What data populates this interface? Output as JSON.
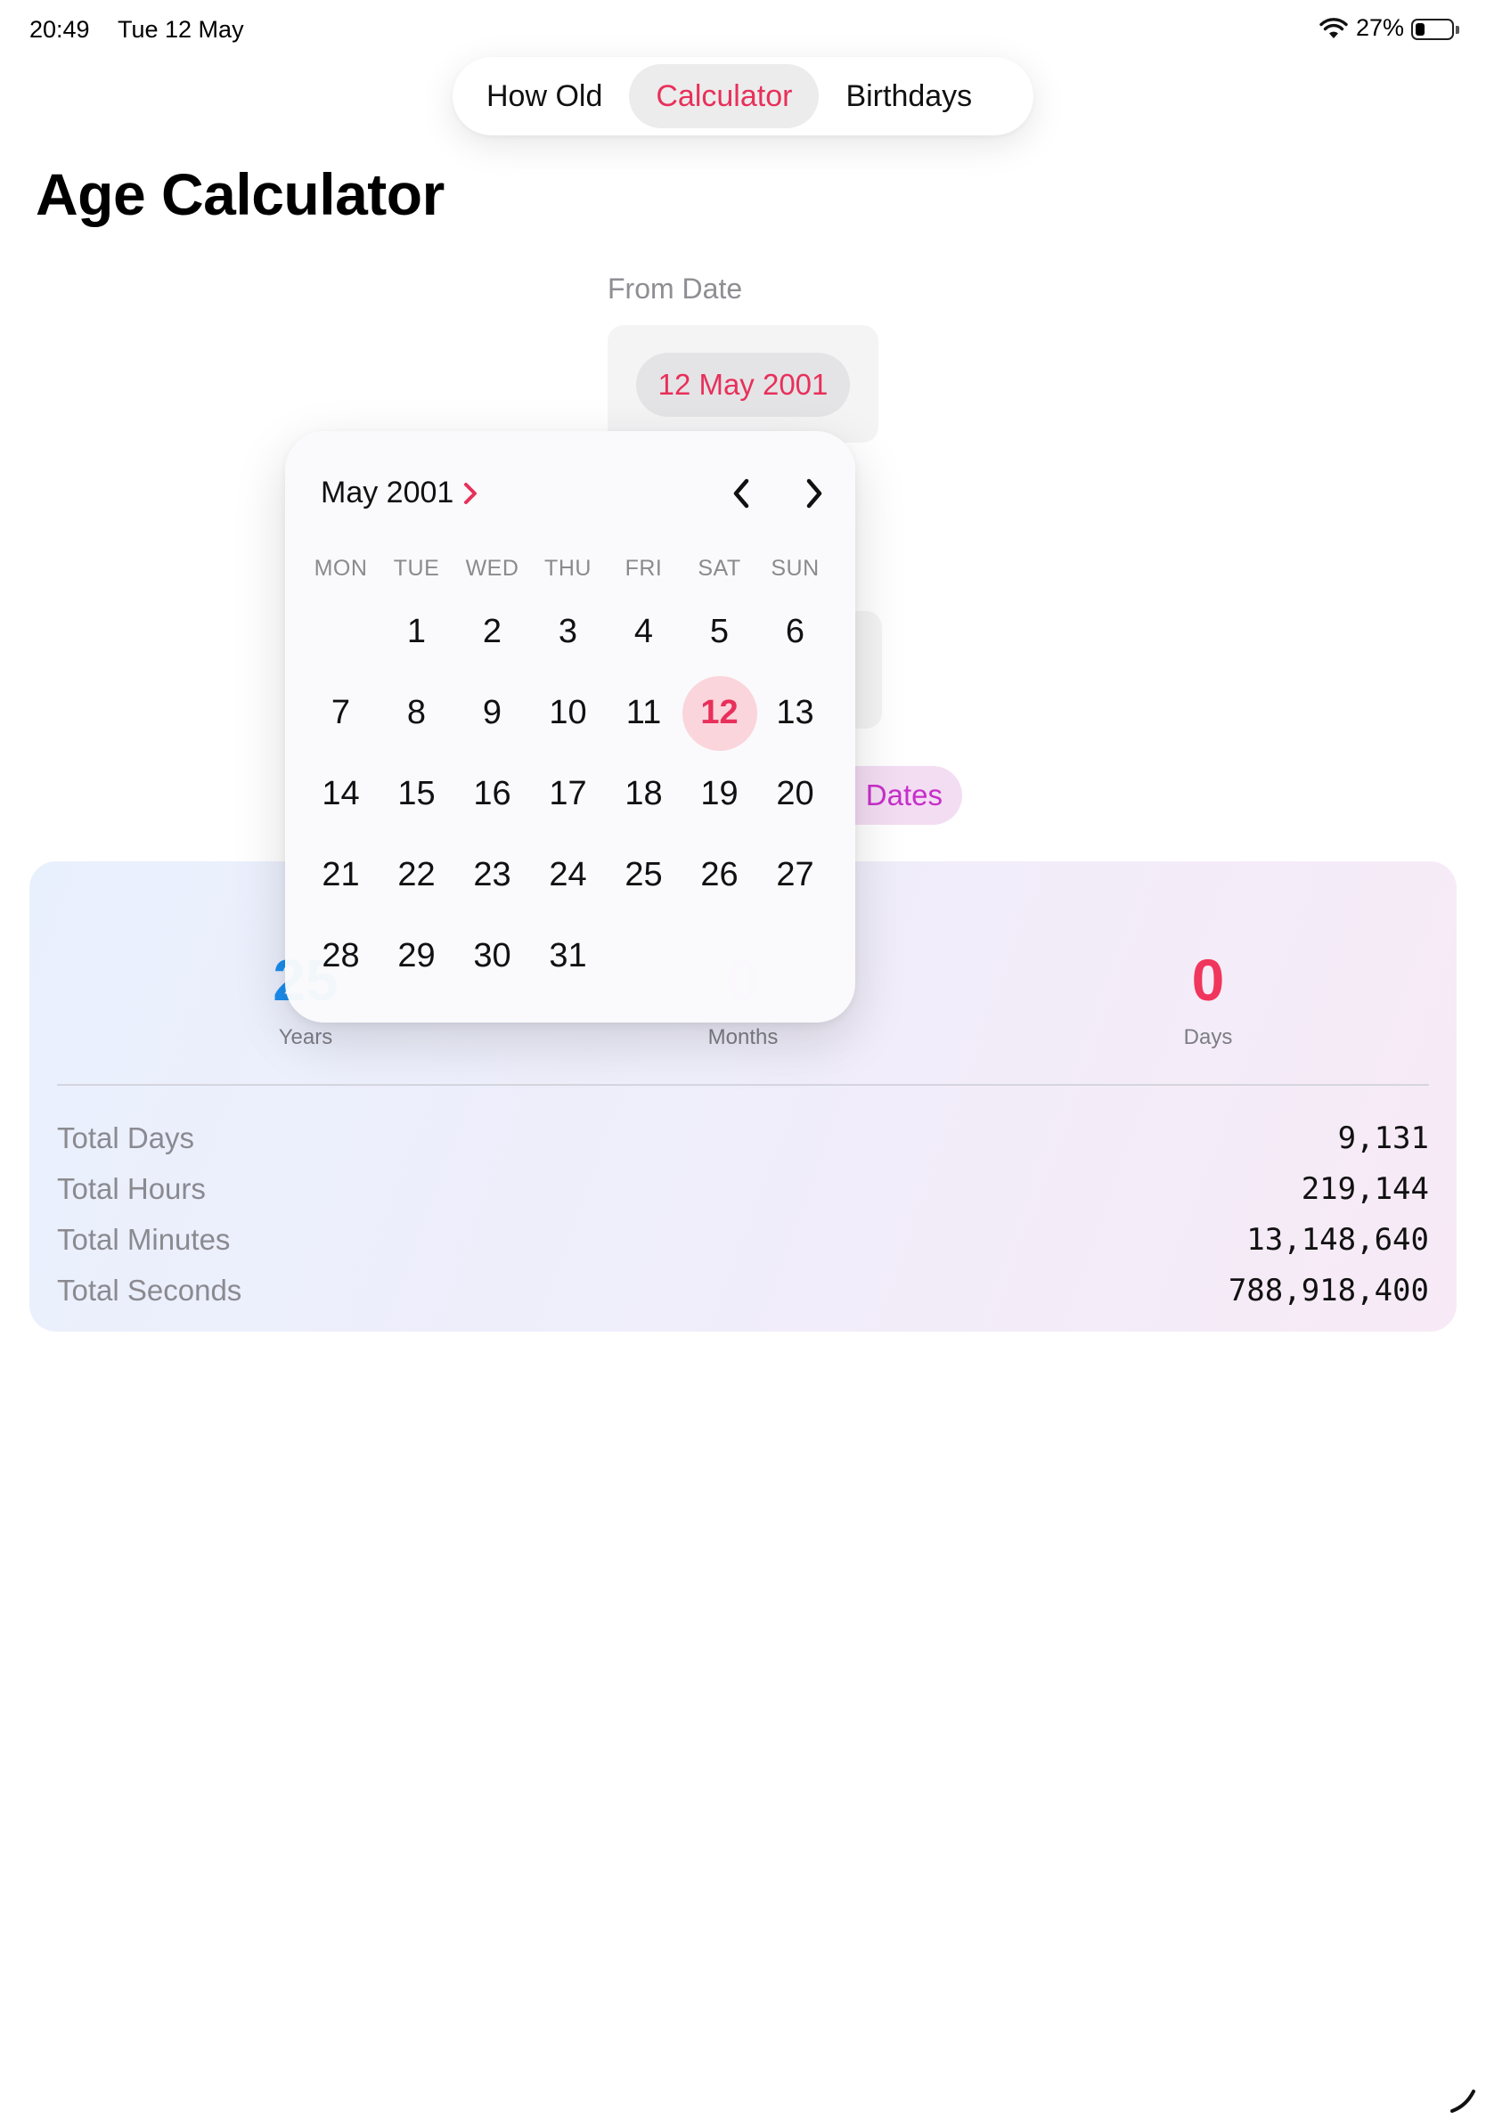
{
  "status": {
    "time": "20:49",
    "date": "Tue 12 May",
    "battery": "27%",
    "battery_level": 0.27
  },
  "tabs": [
    {
      "label": "How Old",
      "active": false
    },
    {
      "label": "Calculator",
      "active": true
    },
    {
      "label": "Birthdays",
      "active": false
    }
  ],
  "page_title": "Age Calculator",
  "from_date": {
    "label": "From Date",
    "value": "12 May 2001"
  },
  "dates_button": "Dates",
  "calendar": {
    "month_title": "May 2001",
    "weekdays": [
      "MON",
      "TUE",
      "WED",
      "THU",
      "FRI",
      "SAT",
      "SUN"
    ],
    "leading_blanks": 1,
    "days_in_month": 31,
    "selected_day": 12
  },
  "results": {
    "years": {
      "value": "25",
      "label": "Years"
    },
    "months": {
      "value": "0",
      "label": "Months"
    },
    "days": {
      "value": "0",
      "label": "Days"
    },
    "totals": [
      {
        "label": "Total Days",
        "value": "9,131"
      },
      {
        "label": "Total Hours",
        "value": "219,144"
      },
      {
        "label": "Total Minutes",
        "value": "13,148,640"
      },
      {
        "label": "Total Seconds",
        "value": "788,918,400"
      }
    ]
  },
  "colors": {
    "accent": "#e8305a",
    "years": "#1b8ff0",
    "days": "#f0365c",
    "dates_button": "#c72fc9"
  }
}
